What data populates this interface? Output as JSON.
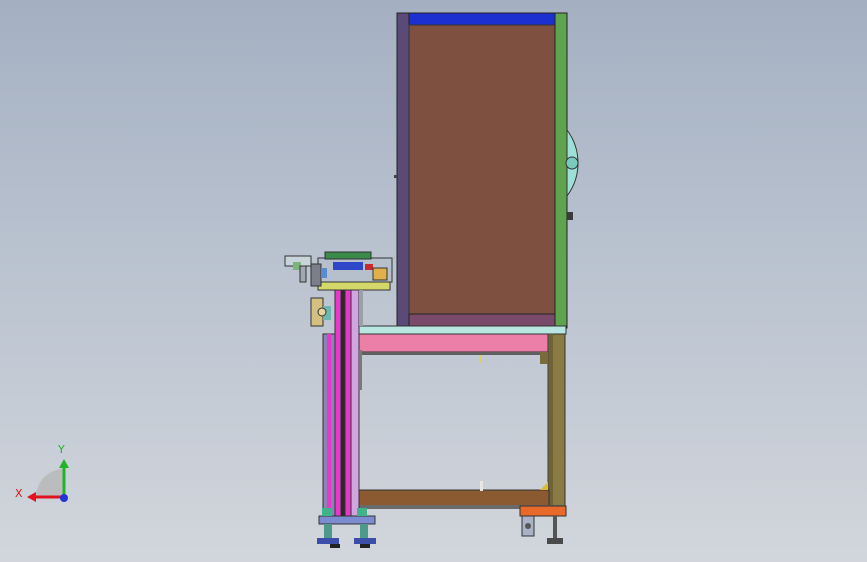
{
  "viewport": {
    "background_top": "#a4b0c2",
    "background_bottom": "#d2d6dc"
  },
  "triad": {
    "x_label": "X",
    "y_label": "Y",
    "x_color": "#e0141e",
    "y_color": "#1fb52a",
    "z_color": "#2233d8"
  },
  "part_colors": {
    "cabinet_panel": "#7d5040",
    "cabinet_top": "#1c2fd0",
    "cabinet_left": "#5a4a78",
    "cabinet_right": "#5fa34f",
    "table_top": "#b8e6e0",
    "table_rail": "#ec7fa8",
    "frame_leg": "#8a7a44",
    "bottom_beam": "#8b5a30",
    "column": "#e838c8",
    "caster": "#e86a2a"
  }
}
